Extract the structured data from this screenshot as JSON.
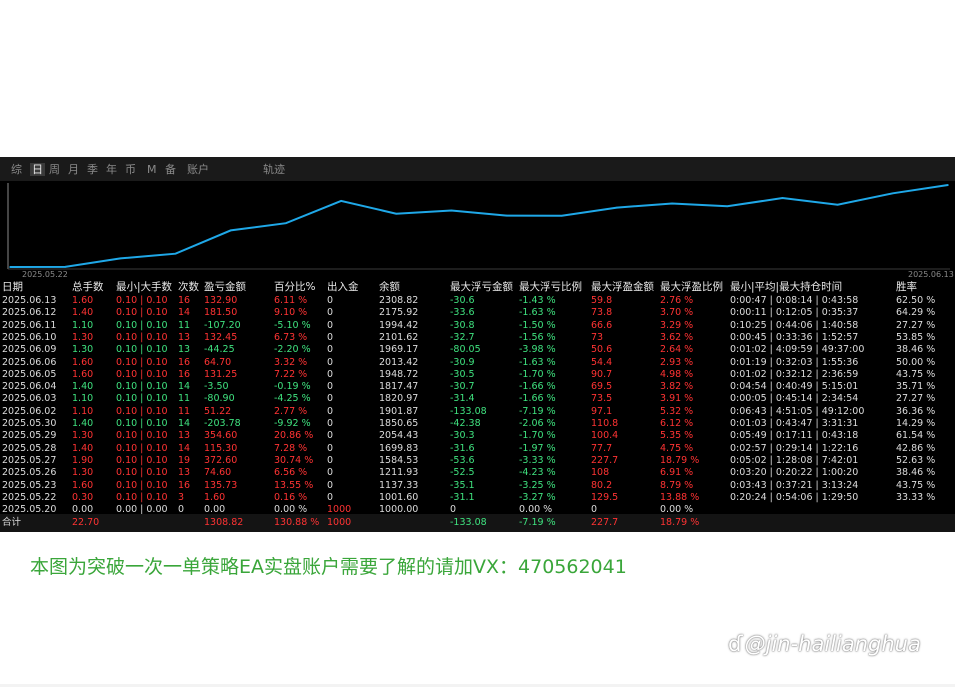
{
  "tabs": [
    {
      "label": "综",
      "active": false
    },
    {
      "label": "日",
      "active": true
    },
    {
      "label": "周",
      "active": false
    },
    {
      "label": "月",
      "active": false
    },
    {
      "label": "季",
      "active": false
    },
    {
      "label": "年",
      "active": false
    },
    {
      "label": "币",
      "active": false
    },
    {
      "label": "M",
      "active": false
    },
    {
      "label": "备",
      "active": false
    },
    {
      "label": "账户",
      "active": false
    },
    {
      "label": "轨迹",
      "active": false
    }
  ],
  "chart_data": {
    "type": "line",
    "x_start_label": "2025.05.22",
    "x_end_label": "2025.06.13",
    "colors": {
      "line": "#1fa8e8",
      "axis": "#8a8a8a"
    },
    "x": [
      "2025.05.20",
      "2025.05.22",
      "2025.05.23",
      "2025.05.26",
      "2025.05.27",
      "2025.05.28",
      "2025.05.29",
      "2025.05.30",
      "2025.06.02",
      "2025.06.03",
      "2025.06.04",
      "2025.06.05",
      "2025.06.06",
      "2025.06.09",
      "2025.06.10",
      "2025.06.11",
      "2025.06.12",
      "2025.06.13"
    ],
    "values": [
      1000.0,
      1001.6,
      1137.33,
      1211.93,
      1584.53,
      1699.83,
      2054.43,
      1850.65,
      1901.87,
      1820.97,
      1817.47,
      1948.72,
      2013.42,
      1969.17,
      2101.62,
      1994.42,
      2175.92,
      2308.82
    ]
  },
  "table": {
    "columns": [
      "日期",
      "总手数",
      "最小|大手数",
      "次数",
      "盈亏金额",
      "百分比%",
      "出入金",
      "余额",
      "最大浮亏金额",
      "最大浮亏比例",
      "最大浮盈金额",
      "最大浮盈比例",
      "最小|平均|最大持仓时间",
      "胜率"
    ],
    "rows": [
      [
        "2025.06.13",
        "1.60",
        "0.10 | 0.10",
        "16",
        "132.90",
        "6.11 %",
        "0",
        "2308.82",
        "-30.6",
        "-1.43 %",
        "59.8",
        "2.76 %",
        "0:00:47 | 0:08:14 | 0:43:58",
        "62.50 %"
      ],
      [
        "2025.06.12",
        "1.40",
        "0.10 | 0.10",
        "14",
        "181.50",
        "9.10 %",
        "0",
        "2175.92",
        "-33.6",
        "-1.63 %",
        "73.8",
        "3.70 %",
        "0:00:11 | 0:12:05 | 0:35:37",
        "64.29 %"
      ],
      [
        "2025.06.11",
        "1.10",
        "0.10 | 0.10",
        "11",
        "-107.20",
        "-5.10 %",
        "0",
        "1994.42",
        "-30.8",
        "-1.50 %",
        "66.6",
        "3.29 %",
        "0:10:25 | 0:44:06 | 1:40:58",
        "27.27 %"
      ],
      [
        "2025.06.10",
        "1.30",
        "0.10 | 0.10",
        "13",
        "132.45",
        "6.73 %",
        "0",
        "2101.62",
        "-32.7",
        "-1.56 %",
        "73",
        "3.62 %",
        "0:00:45 | 0:33:36 | 1:52:57",
        "53.85 %"
      ],
      [
        "2025.06.09",
        "1.30",
        "0.10 | 0.10",
        "13",
        "-44.25",
        "-2.20 %",
        "0",
        "1969.17",
        "-80.05",
        "-3.98 %",
        "50.6",
        "2.64 %",
        "0:01:02 | 4:09:59 | 49:37:00",
        "38.46 %"
      ],
      [
        "2025.06.06",
        "1.60",
        "0.10 | 0.10",
        "16",
        "64.70",
        "3.32 %",
        "0",
        "2013.42",
        "-30.9",
        "-1.63 %",
        "54.4",
        "2.93 %",
        "0:01:19 | 0:32:03 | 1:55:36",
        "50.00 %"
      ],
      [
        "2025.06.05",
        "1.60",
        "0.10 | 0.10",
        "16",
        "131.25",
        "7.22 %",
        "0",
        "1948.72",
        "-30.5",
        "-1.70 %",
        "90.7",
        "4.98 %",
        "0:01:02 | 0:32:12 | 2:36:59",
        "43.75 %"
      ],
      [
        "2025.06.04",
        "1.40",
        "0.10 | 0.10",
        "14",
        "-3.50",
        "-0.19 %",
        "0",
        "1817.47",
        "-30.7",
        "-1.66 %",
        "69.5",
        "3.82 %",
        "0:04:54 | 0:40:49 | 5:15:01",
        "35.71 %"
      ],
      [
        "2025.06.03",
        "1.10",
        "0.10 | 0.10",
        "11",
        "-80.90",
        "-4.25 %",
        "0",
        "1820.97",
        "-31.4",
        "-1.66 %",
        "73.5",
        "3.91 %",
        "0:00:05 | 0:45:14 | 2:34:54",
        "27.27 %"
      ],
      [
        "2025.06.02",
        "1.10",
        "0.10 | 0.10",
        "11",
        "51.22",
        "2.77 %",
        "0",
        "1901.87",
        "-133.08",
        "-7.19 %",
        "97.1",
        "5.32 %",
        "0:06:43 | 4:51:05 | 49:12:00",
        "36.36 %"
      ],
      [
        "2025.05.30",
        "1.40",
        "0.10 | 0.10",
        "14",
        "-203.78",
        "-9.92 %",
        "0",
        "1850.65",
        "-42.38",
        "-2.06 %",
        "110.8",
        "6.12 %",
        "0:01:03 | 0:43:47 | 3:31:31",
        "14.29 %"
      ],
      [
        "2025.05.29",
        "1.30",
        "0.10 | 0.10",
        "13",
        "354.60",
        "20.86 %",
        "0",
        "2054.43",
        "-30.3",
        "-1.70 %",
        "100.4",
        "5.35 %",
        "0:05:49 | 0:17:11 | 0:43:18",
        "61.54 %"
      ],
      [
        "2025.05.28",
        "1.40",
        "0.10 | 0.10",
        "14",
        "115.30",
        "7.28 %",
        "0",
        "1699.83",
        "-31.6",
        "-1.97 %",
        "77.7",
        "4.75 %",
        "0:02:57 | 0:29:14 | 1:22:16",
        "42.86 %"
      ],
      [
        "2025.05.27",
        "1.90",
        "0.10 | 0.10",
        "19",
        "372.60",
        "30.74 %",
        "0",
        "1584.53",
        "-53.6",
        "-3.33 %",
        "227.7",
        "18.79 %",
        "0:05:02 | 1:28:08 | 7:42:01",
        "52.63 %"
      ],
      [
        "2025.05.26",
        "1.30",
        "0.10 | 0.10",
        "13",
        "74.60",
        "6.56 %",
        "0",
        "1211.93",
        "-52.5",
        "-4.23 %",
        "108",
        "6.91 %",
        "0:03:20 | 0:20:22 | 1:00:20",
        "38.46 %"
      ],
      [
        "2025.05.23",
        "1.60",
        "0.10 | 0.10",
        "16",
        "135.73",
        "13.55 %",
        "0",
        "1137.33",
        "-35.1",
        "-3.25 %",
        "80.2",
        "8.79 %",
        "0:03:43 | 0:37:21 | 3:13:24",
        "43.75 %"
      ],
      [
        "2025.05.22",
        "0.30",
        "0.10 | 0.10",
        "3",
        "1.60",
        "0.16 %",
        "0",
        "1001.60",
        "-31.1",
        "-3.27 %",
        "129.5",
        "13.88 %",
        "0:20:24 | 0:54:06 | 1:29:50",
        "33.33 %"
      ],
      [
        "2025.05.20",
        "0.00",
        "0.00 | 0.00",
        "0",
        "0.00",
        "0.00 %",
        "1000",
        "1000.00",
        "0",
        "0.00 %",
        "0",
        "0.00 %",
        "",
        ""
      ]
    ],
    "totals": {
      "label": "合计",
      "lots": "22.70",
      "pnl": "1308.82",
      "pct": "130.88 %",
      "deposit": "1000",
      "max_float_loss": "-133.08",
      "max_float_loss_pct": "-7.19 %",
      "max_float_profit": "227.7",
      "max_float_profit_pct": "18.79 %"
    }
  },
  "caption": "本图为突破一次一单策略EA实盘账户需要了解的请加VX：470562041",
  "watermark": "@jin-hailianghua"
}
